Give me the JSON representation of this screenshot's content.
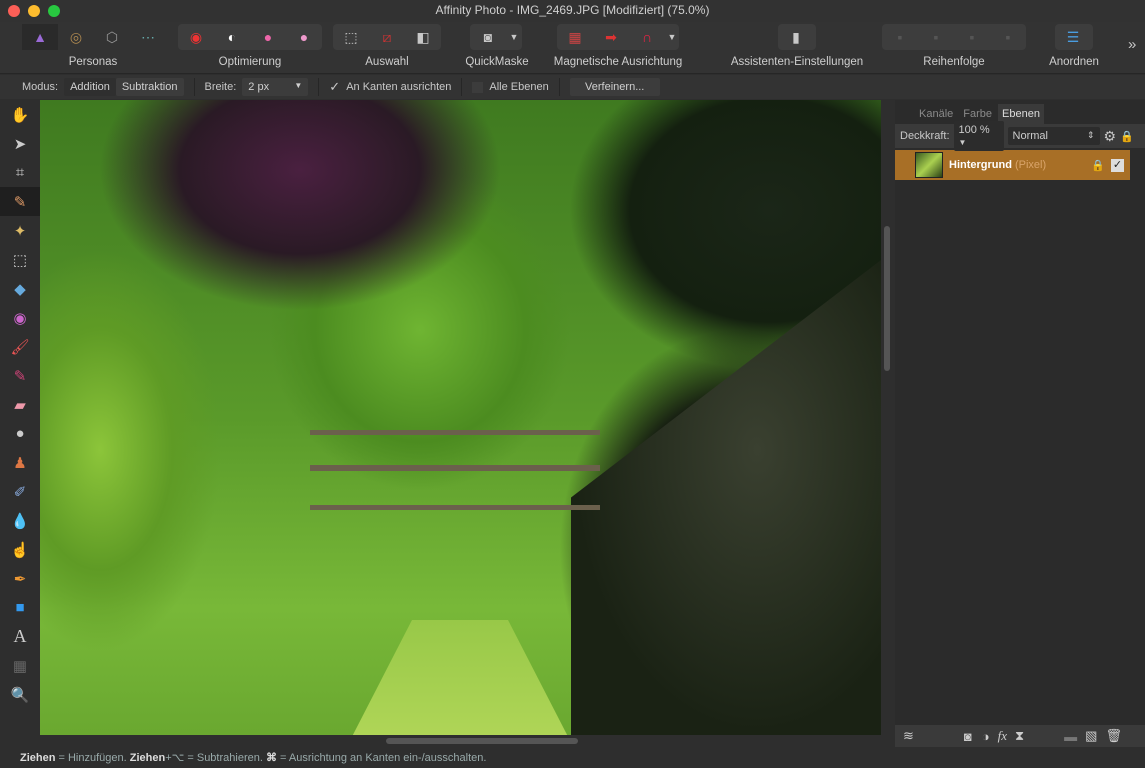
{
  "window": {
    "title": "Affinity Photo - IMG_2469.JPG [Modifiziert] (75.0%)"
  },
  "toolbar": {
    "groups": [
      {
        "label": "Personas",
        "icons": [
          "photo-persona-icon",
          "liquify-persona-icon",
          "develop-persona-icon",
          "export-persona-icon"
        ]
      },
      {
        "label": "Optimierung",
        "icons": [
          "auto-levels-icon",
          "auto-contrast-icon",
          "auto-colors-icon",
          "auto-white-balance-icon"
        ]
      },
      {
        "label": "Auswahl",
        "icons": [
          "select-all-icon",
          "deselect-icon",
          "invert-selection-icon"
        ]
      },
      {
        "label": "QuickMaske",
        "icons": [
          "quick-mask-icon"
        ]
      },
      {
        "label": "Magnetische Ausrichtung",
        "icons": [
          "snapping-grid-icon",
          "snapping-move-icon",
          "magnet-icon"
        ]
      },
      {
        "label": "Assistenten-Einstellungen",
        "icons": [
          "assistant-icon"
        ]
      },
      {
        "label": "Reihenfolge",
        "icons": [
          "move-to-back-icon",
          "move-back-icon",
          "move-forward-icon",
          "move-to-front-icon"
        ]
      },
      {
        "label": "Anordnen",
        "icons": [
          "align-left-icon"
        ]
      }
    ],
    "overflow": "»"
  },
  "context": {
    "mode_label": "Modus:",
    "mode_add": "Addition",
    "mode_subtract": "Subtraktion",
    "width_label": "Breite:",
    "width_value": "2 px",
    "snap_edges": "An Kanten ausrichten",
    "snap_edges_checked": true,
    "all_layers": "Alle Ebenen",
    "all_layers_checked": false,
    "refine": "Verfeinern..."
  },
  "tools": [
    "hand-tool",
    "move-tool",
    "crop-tool",
    "selection-brush-tool",
    "flood-select-tool",
    "marquee-tool",
    "flood-fill-tool",
    "color-picker-tool",
    "paint-brush-tool",
    "color-replacement-tool",
    "erase-tool",
    "dodge-tool",
    "clone-tool",
    "inpainting-tool",
    "blur-tool",
    "smudge-tool",
    "pen-tool",
    "shape-tool",
    "text-tool",
    "mesh-warp-tool",
    "zoom-tool"
  ],
  "panel": {
    "tabs": [
      "Kanäle",
      "Farbe",
      "Ebenen"
    ],
    "active_tab": "Ebenen",
    "opacity_label": "Deckkraft:",
    "opacity_value": "100 %",
    "blend_mode": "Normal",
    "layers": [
      {
        "name": "Hintergrund",
        "type": "(Pixel)",
        "visible": true
      }
    ]
  },
  "status": {
    "drag": "Ziehen",
    "add": " = Hinzufügen. ",
    "drag2": "Ziehen",
    "alt": "+⌥ = Subtrahieren. ",
    "cmd": "⌘",
    "rest": " = Ausrichtung an Kanten ein-/ausschalten."
  },
  "colors": {
    "accent": "#a86f26",
    "background": "#2e2e2e"
  }
}
